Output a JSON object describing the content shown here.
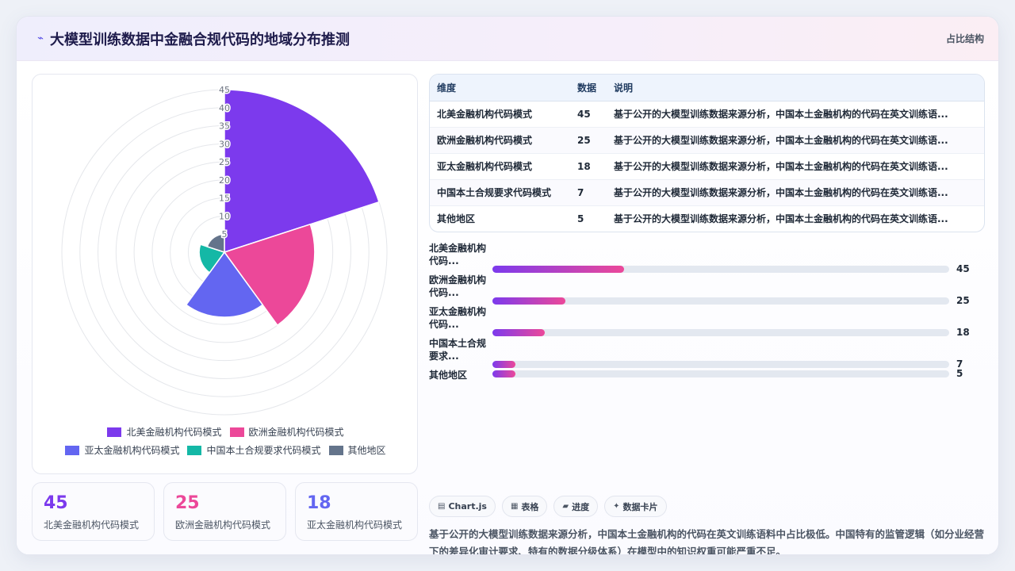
{
  "header": {
    "title": "大模型训练数据中金融合规代码的地域分布推测",
    "tag": "占比结构",
    "icon": "chart-line-icon"
  },
  "chart_data": {
    "type": "polarArea",
    "title": "",
    "categories": [
      "北美金融机构代码模式",
      "欧洲金融机构代码模式",
      "亚太金融机构代码模式",
      "中国本土合规要求代码模式",
      "其他地区"
    ],
    "values": [
      45,
      25,
      18,
      7,
      5
    ],
    "colors": [
      "#7c3aed",
      "#ec4899",
      "#6366f1",
      "#14b8a6",
      "#64748b"
    ],
    "rlim": [
      0,
      45
    ],
    "ticks": [
      5,
      10,
      15,
      20,
      25,
      30,
      35,
      40,
      45
    ],
    "grid": true,
    "legend_position": "bottom"
  },
  "stats": [
    {
      "value": "45",
      "label": "北美金融机构代码模式",
      "color": "#7c3aed"
    },
    {
      "value": "25",
      "label": "欧洲金融机构代码模式",
      "color": "#ec4899"
    },
    {
      "value": "18",
      "label": "亚太金融机构代码模式",
      "color": "#6366f1"
    }
  ],
  "table": {
    "headers": [
      "维度",
      "数据",
      "说明"
    ],
    "rows": [
      [
        "北美金融机构代码模式",
        "45",
        "基于公开的大模型训练数据来源分析，中国本土金融机构的代码在英文训练语..."
      ],
      [
        "欧洲金融机构代码模式",
        "25",
        "基于公开的大模型训练数据来源分析，中国本土金融机构的代码在英文训练语..."
      ],
      [
        "亚太金融机构代码模式",
        "18",
        "基于公开的大模型训练数据来源分析，中国本土金融机构的代码在英文训练语..."
      ],
      [
        "中国本土合规要求代码模式",
        "7",
        "基于公开的大模型训练数据来源分析，中国本土金融机构的代码在英文训练语..."
      ],
      [
        "其他地区",
        "5",
        "基于公开的大模型训练数据来源分析，中国本土金融机构的代码在英文训练语..."
      ]
    ]
  },
  "bars": [
    {
      "label": "北美金融机构代码...",
      "value": "45",
      "fraction": 0.2875
    },
    {
      "label": "欧洲金融机构代码...",
      "value": "25",
      "fraction": 0.16
    },
    {
      "label": "亚太金融机构代码...",
      "value": "18",
      "fraction": 0.115
    },
    {
      "label": "中国本土合规要求...",
      "value": "7",
      "fraction": 0.05
    },
    {
      "label": "其他地区",
      "value": "5",
      "fraction": 0.05
    }
  ],
  "chips": [
    {
      "icon": "▤",
      "label": "Chart.js"
    },
    {
      "icon": "▦",
      "label": "表格"
    },
    {
      "icon": "▰",
      "label": "进度"
    },
    {
      "icon": "✦",
      "label": "数据卡片"
    }
  ],
  "description": "基于公开的大模型训练数据来源分析，中国本土金融机构的代码在英文训练语料中占比极低。中国特有的监管逻辑（如分业经营下的差异化审计要求、特有的数据分级体系）在模型中的知识权重可能严重不足。"
}
